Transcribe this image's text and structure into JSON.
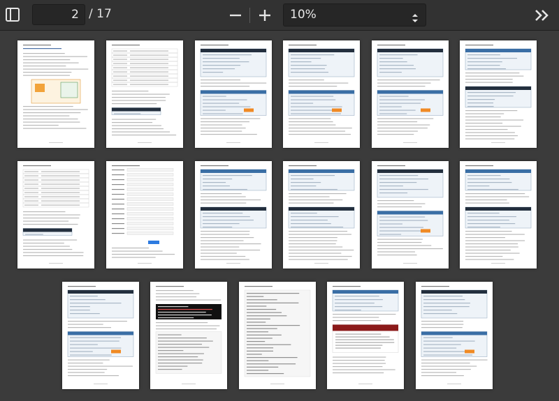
{
  "toolbar": {
    "current_page": "2",
    "total_pages": "/ 17",
    "zoom_level": "10%"
  },
  "icons": {
    "sidebar": "sidebar-toggle-icon",
    "zoom_out": "minus-icon",
    "zoom_in": "plus-icon",
    "zoom_arrows": "up-down-arrows-icon",
    "more": "double-chevron-right-icon"
  },
  "colors": {
    "toolbar_bg": "#323232",
    "viewer_bg": "#3b3b3b",
    "page_bg": "#ffffff"
  },
  "thumbnails": [
    {
      "page": 1,
      "variant": "text-figure"
    },
    {
      "page": 2,
      "variant": "table-text"
    },
    {
      "page": 3,
      "variant": "screenshot-heavy"
    },
    {
      "page": 4,
      "variant": "screenshot-heavy"
    },
    {
      "page": 5,
      "variant": "screenshot-heavy"
    },
    {
      "page": 6,
      "variant": "screenshot-text"
    },
    {
      "page": 7,
      "variant": "table-text"
    },
    {
      "page": 8,
      "variant": "form"
    },
    {
      "page": 9,
      "variant": "screenshot-text"
    },
    {
      "page": 10,
      "variant": "screenshot-text"
    },
    {
      "page": 11,
      "variant": "screenshot-heavy"
    },
    {
      "page": 12,
      "variant": "screenshot-text"
    },
    {
      "page": 13,
      "variant": "screenshot-heavy"
    },
    {
      "page": 14,
      "variant": "terminal"
    },
    {
      "page": 15,
      "variant": "code"
    },
    {
      "page": 16,
      "variant": "red-banner"
    },
    {
      "page": 17,
      "variant": "screenshot-heavy"
    }
  ]
}
